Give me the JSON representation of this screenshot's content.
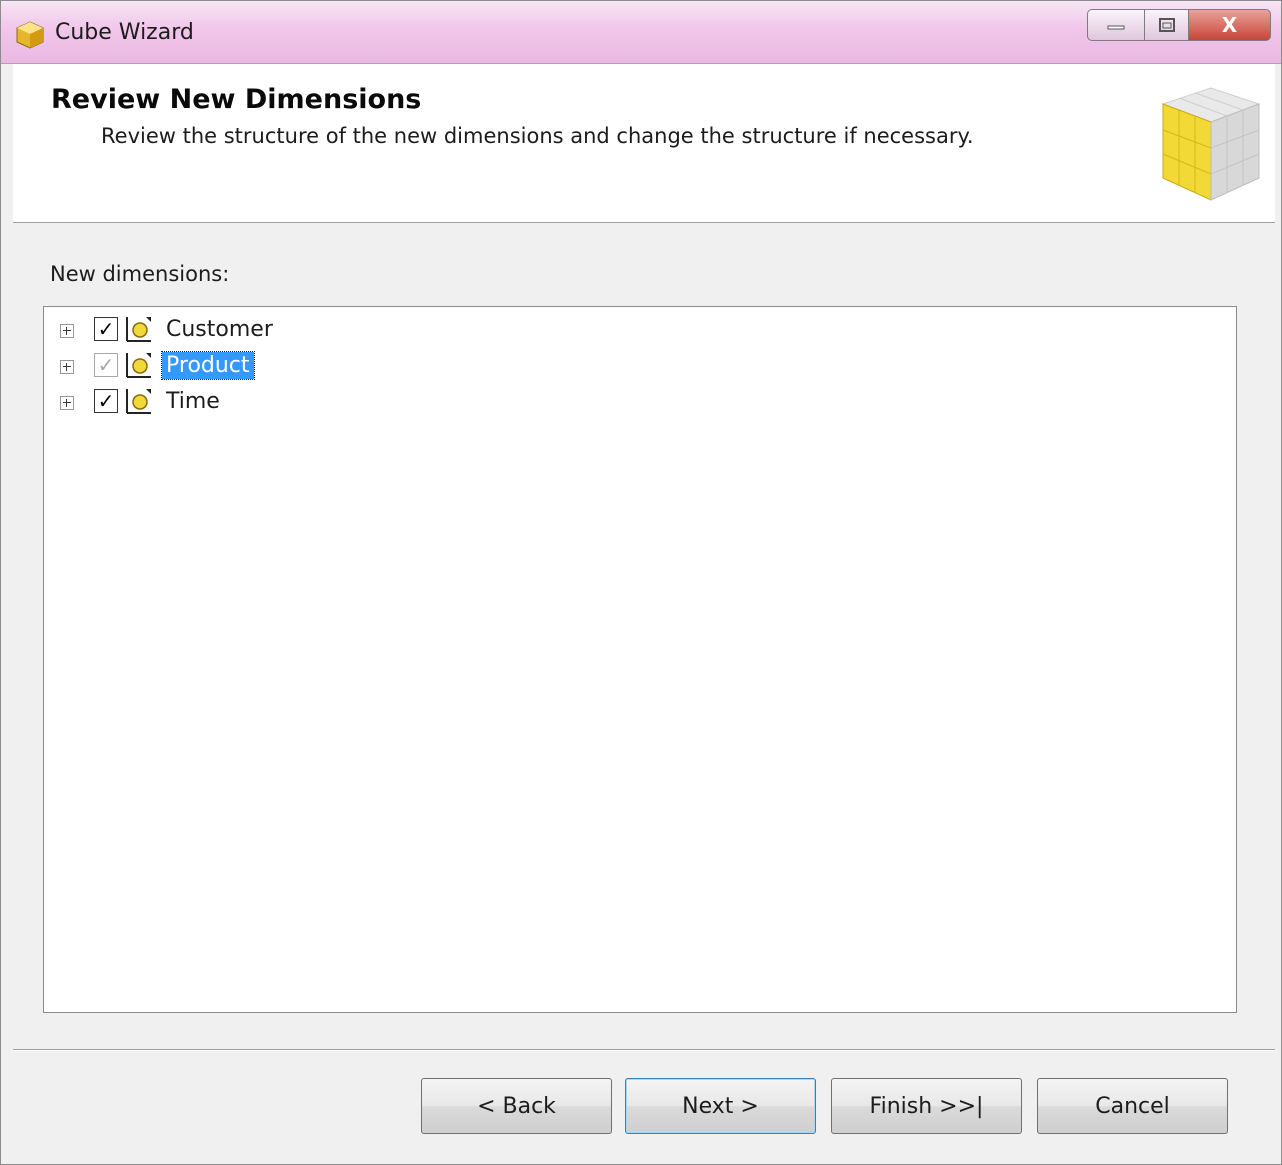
{
  "window": {
    "title": "Cube Wizard",
    "controls": {
      "minimize": "minimize",
      "maximize": "maximize",
      "close": "X"
    }
  },
  "header": {
    "title": "Review New Dimensions",
    "description": "Review the structure of the new dimensions and change the structure if necessary."
  },
  "main": {
    "label": "New dimensions:",
    "dimensions": [
      {
        "label": "Customer",
        "checked": true,
        "selected": false
      },
      {
        "label": "Product",
        "checked": true,
        "selected": true,
        "disabled": true
      },
      {
        "label": "Time",
        "checked": true,
        "selected": false
      }
    ]
  },
  "buttons": {
    "back": "< Back",
    "next": "Next >",
    "finish": "Finish >>|",
    "cancel": "Cancel"
  },
  "colors": {
    "selection": "#3399ff",
    "titlebar": "#f1c6ea",
    "cube_yellow": "#f2d93a",
    "close_red": "#c74437"
  },
  "icons": [
    "cube-icon",
    "dimension-icon",
    "expand-icon",
    "checkbox-icon"
  ]
}
